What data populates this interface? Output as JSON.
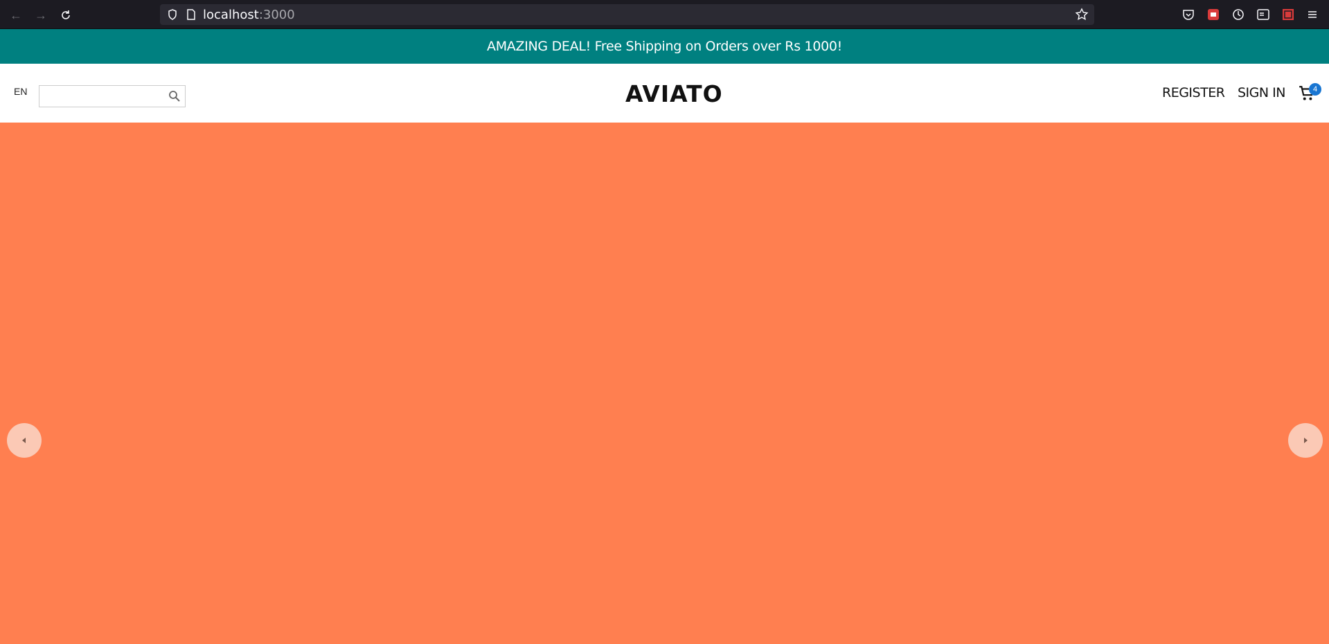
{
  "browser": {
    "url_host": "localhost",
    "url_port": ":3000"
  },
  "promo": {
    "text": "AMAZING DEAL! Free Shipping on Orders over Rs 1000!"
  },
  "header": {
    "language": "EN",
    "search_placeholder": "",
    "logo": "AVIATO",
    "register_label": "REGISTER",
    "signin_label": "SIGN IN",
    "cart_count": "4"
  },
  "colors": {
    "promo_bg": "#008080",
    "hero_bg": "#ff7f50",
    "badge": "#1976d2"
  },
  "icons": [
    "back-icon",
    "forward-icon",
    "reload-icon",
    "shield-icon",
    "page-icon",
    "star-icon",
    "pocket-icon",
    "extension-icon",
    "sync-icon",
    "reader-icon",
    "addon-icon",
    "menu-icon",
    "search-icon",
    "cart-icon",
    "chevron-left-icon",
    "chevron-right-icon"
  ]
}
